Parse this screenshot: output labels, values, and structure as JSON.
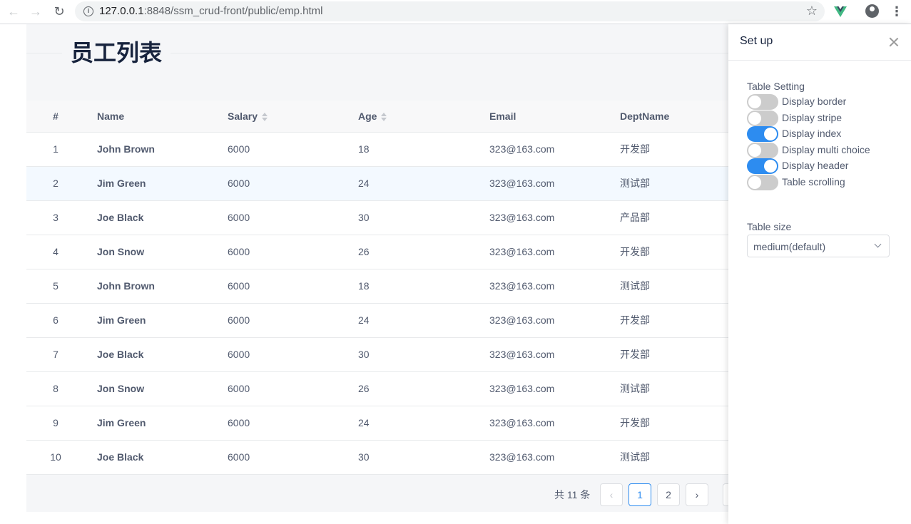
{
  "browser": {
    "url_host": "127.0.0.1",
    "url_rest": ":8848/ssm_crud-front/public/emp.html",
    "info_glyph": "i",
    "back_glyph": "←",
    "forward_glyph": "→",
    "reload_glyph": "↻",
    "star_glyph": "☆",
    "menu_glyph": "⋮"
  },
  "page": {
    "title": "员工列表",
    "columns": {
      "index": "#",
      "name": "Name",
      "salary": "Salary",
      "age": "Age",
      "email": "Email",
      "dept": "DeptName"
    },
    "rows": [
      {
        "idx": "1",
        "name": "John Brown",
        "salary": "6000",
        "age": "18",
        "email": "323@163.com",
        "dept": "开发部"
      },
      {
        "idx": "2",
        "name": "Jim Green",
        "salary": "6000",
        "age": "24",
        "email": "323@163.com",
        "dept": "测试部"
      },
      {
        "idx": "3",
        "name": "Joe Black",
        "salary": "6000",
        "age": "30",
        "email": "323@163.com",
        "dept": "产品部"
      },
      {
        "idx": "4",
        "name": "Jon Snow",
        "salary": "6000",
        "age": "26",
        "email": "323@163.com",
        "dept": "开发部"
      },
      {
        "idx": "5",
        "name": "John Brown",
        "salary": "6000",
        "age": "18",
        "email": "323@163.com",
        "dept": "测试部"
      },
      {
        "idx": "6",
        "name": "Jim Green",
        "salary": "6000",
        "age": "24",
        "email": "323@163.com",
        "dept": "开发部"
      },
      {
        "idx": "7",
        "name": "Joe Black",
        "salary": "6000",
        "age": "30",
        "email": "323@163.com",
        "dept": "开发部"
      },
      {
        "idx": "8",
        "name": "Jon Snow",
        "salary": "6000",
        "age": "26",
        "email": "323@163.com",
        "dept": "测试部"
      },
      {
        "idx": "9",
        "name": "Jim Green",
        "salary": "6000",
        "age": "24",
        "email": "323@163.com",
        "dept": "开发部"
      },
      {
        "idx": "10",
        "name": "Joe Black",
        "salary": "6000",
        "age": "30",
        "email": "323@163.com",
        "dept": "测试部"
      }
    ],
    "pagination": {
      "total": "共 11 条",
      "prev_glyph": "‹",
      "next_glyph": "›",
      "pages": [
        "1",
        "2"
      ],
      "current": "1"
    }
  },
  "drawer": {
    "title": "Set up",
    "table_setting_label": "Table Setting",
    "switches": [
      {
        "label": "Display border",
        "on": false
      },
      {
        "label": "Display stripe",
        "on": false
      },
      {
        "label": "Display index",
        "on": true
      },
      {
        "label": "Display multi choice",
        "on": false
      },
      {
        "label": "Display header",
        "on": true
      },
      {
        "label": "Table scrolling",
        "on": false
      }
    ],
    "table_size_label": "Table size",
    "table_size_value": "medium(default)"
  },
  "colors": {
    "accent": "#2d8cf0",
    "title": "#17233d",
    "row_hover": "#f3f9ff",
    "vue_green": "#41b883"
  }
}
